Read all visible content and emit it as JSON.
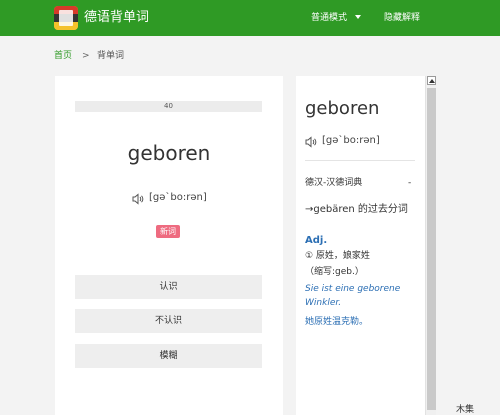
{
  "navbar": {
    "brand": "德语背单词",
    "logo_icon": "book-flag-icon",
    "mode_menu": "普通模式",
    "hide_toggle": "隐藏解释",
    "bg_color": "#2f9a25"
  },
  "breadcrumb": {
    "home": "首页",
    "separator": ">",
    "current": "背单词"
  },
  "card": {
    "counter": "40",
    "word": "geboren",
    "phonetic": "[gə`bo:rən]",
    "speaker_icon": "speaker-icon",
    "badge": "新词",
    "buttons": {
      "know": "认识",
      "dont_know": "不认识",
      "vague": "模糊"
    }
  },
  "dictionary": {
    "word": "geboren",
    "phonetic": "[gə`bo:rən]",
    "source": "德汉-汉德词典",
    "dash": "-",
    "definition": "→gebären 的过去分词",
    "pos": "Adj.",
    "line1": "① 原姓，娘家姓",
    "line2": "（缩写:geb.）",
    "example": "Sie ist eine geborene Winkler.",
    "translation": "她原姓温克勒。"
  },
  "corner_text": "木集"
}
